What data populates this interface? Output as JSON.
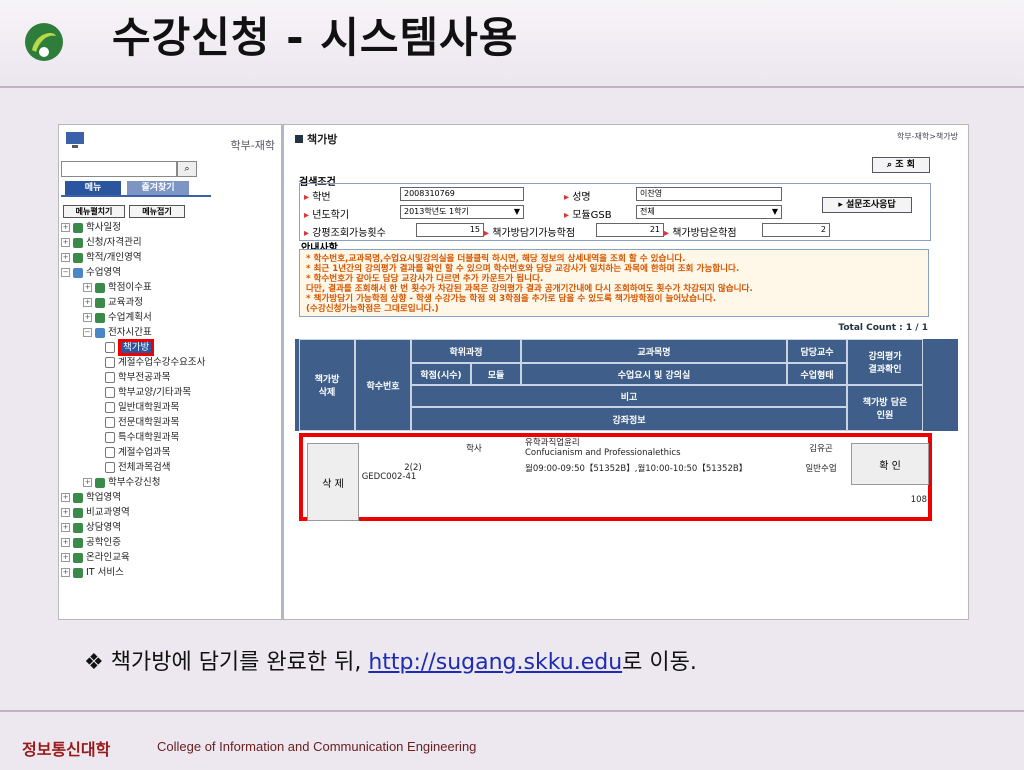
{
  "slide": {
    "title": "수강신청 - 시스템사용",
    "bullet_mark": "❖",
    "bullet_text": "책가방에 담기를 완료한 뒤, ",
    "bullet_link": "http://sugang.skku.edu",
    "bullet_tail": "로 이동.",
    "footer_kr": "정보통신대학",
    "footer_en": "College of Information and Communication Engineering"
  },
  "sidebar": {
    "crumb": "학부-재학",
    "tabs": [
      "메뉴",
      "즐겨찾기"
    ],
    "expand_all": "메뉴펼치기",
    "collapse_all": "메뉴접기",
    "tree": [
      "학사일정",
      "신청/자격관리",
      "학적/개인영역",
      "수업영역",
      "학점이수표",
      "교육과정",
      "수업계획서",
      "전자시간표",
      "책가방",
      "계절수업수강수요조사",
      "학부전공과목",
      "학부교양/기타과목",
      "일반대학원과목",
      "전문대학원과목",
      "특수대학원과목",
      "계절수업과목",
      "전체과목검색",
      "학부수강신청",
      "학업영역",
      "비교과영역",
      "상담영역",
      "공학인증",
      "온라인교육",
      "IT 서비스"
    ]
  },
  "main": {
    "title": "책가방",
    "breadcrumb": "학부-재학>책가방",
    "search_btn": "조 회",
    "cond_title": "검색조건",
    "labels": {
      "student_no": "학번",
      "name": "성명",
      "year_term": "년도학기",
      "module": "모듈GSB",
      "lecture_count": "강평조회가능횟수",
      "cart_credit": "책가방담기가능학점",
      "cart_taken": "책가방담은학점"
    },
    "values": {
      "student_no": "2008310769",
      "name": "이찬영",
      "year_term": "2013학년도 1학기",
      "module": "전체",
      "lecture_count": "15",
      "cart_credit": "21",
      "cart_taken": "2"
    },
    "survey_btn": "설문조사응답",
    "notice_title": "안내사항",
    "notice_lines": [
      "* 학수번호,교과목명,수업요시및강의실을 더블클릭 하시면, 해당 정보의 상세내역을 조회 할 수 있습니다.",
      "* 최근 1년간의 강의평가 결과를 확인 할 수 있으며 학수번호와 담당 교강사가 일치하는 과목에 한하며 조회 가능합니다.",
      "* 학수번호가 같아도 담당 교강사가 다르면 추가 카운트가 됩니다.",
      "다만, 결과를 조회해서 한 번 횟수가 차감된 과목은 강의평가 결과 공개기간내에 다시 조회하여도 횟수가 차감되지 않습니다.",
      "* 책가방담기 가능학점 상향 - 학생 수강가능 학점 외 3학점을 추가로 담을 수 있도록 책가방학점이 늘어났습니다.",
      "(수강신청가능학점은 그대로입니다.)"
    ],
    "total": "Total Count : 1 / 1",
    "headers": {
      "delete": "책가방\n삭제",
      "course_no": "학수번호",
      "program": "학위과정",
      "course_name": "교과목명",
      "professor": "담당교수",
      "eval": "강의평가\n결과확인",
      "credit": "학점(시수)",
      "module": "모듈",
      "time_room": "수업요시 및 강의실",
      "type": "수업형태",
      "remark": "비고",
      "cart_count": "책가방 담은\n인원",
      "lecture_info": "강좌정보"
    },
    "row": {
      "delete_btn": "삭 제",
      "course_no": "GEDC002-41",
      "program": "학사",
      "course_name": "유학과직업윤리",
      "course_name_en": "Confucianism and Professionalethics",
      "professor": "김유곤",
      "confirm_btn": "확 인",
      "credit": "2(2)",
      "time_room": "월09:00-09:50【51352B】,월10:00-10:50【51352B】",
      "type": "일반수업",
      "cart_count": "108"
    }
  }
}
